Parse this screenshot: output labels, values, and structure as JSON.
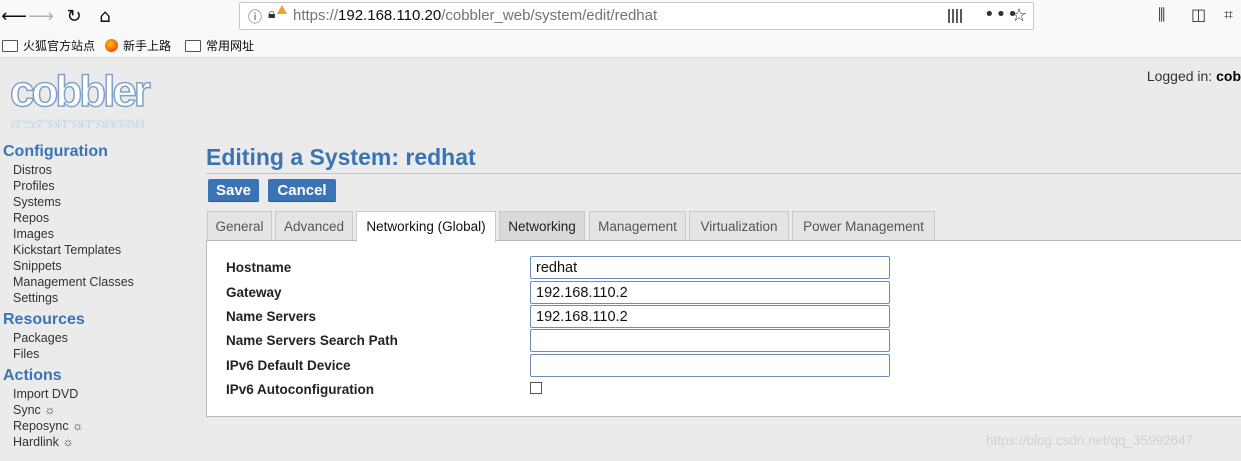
{
  "browser": {
    "url_prefix": "https://",
    "url_host": "192.168.110.20",
    "url_path": "/cobbler_web/system/edit/redhat",
    "bookmarks": [
      "火狐官方站点",
      "新手上路",
      "常用网址"
    ]
  },
  "header": {
    "logo_text": "cobbler",
    "logged_in_label": "Logged in:",
    "logged_in_user": "cob"
  },
  "sidebar": {
    "configuration": {
      "title": "Configuration",
      "items": [
        "Distros",
        "Profiles",
        "Systems",
        "Repos",
        "Images",
        "Kickstart Templates",
        "Snippets",
        "Management Classes",
        "Settings"
      ]
    },
    "resources": {
      "title": "Resources",
      "items": [
        "Packages",
        "Files"
      ]
    },
    "actions": {
      "title": "Actions",
      "items": [
        "Import DVD",
        "Sync ☼",
        "Reposync ☼",
        "Hardlink ☼"
      ]
    }
  },
  "main": {
    "title": "Editing a System: redhat",
    "save_label": "Save",
    "cancel_label": "Cancel",
    "tabs": [
      "General",
      "Advanced",
      "Networking (Global)",
      "Networking",
      "Management",
      "Virtualization",
      "Power Management"
    ],
    "active_tab": "Networking (Global)",
    "fields": {
      "hostname": {
        "label": "Hostname",
        "value": "redhat"
      },
      "gateway": {
        "label": "Gateway",
        "value": "192.168.110.2"
      },
      "name_servers": {
        "label": "Name Servers",
        "value": "192.168.110.2"
      },
      "search_path": {
        "label": "Name Servers Search Path",
        "value": ""
      },
      "ipv6_device": {
        "label": "IPv6 Default Device",
        "value": ""
      },
      "ipv6_autoconf": {
        "label": "IPv6 Autoconfiguration",
        "checked": false
      }
    }
  },
  "watermark": "https://blog.csdn.net/qq_35992647",
  "colors": {
    "accent": "#3b74b6"
  }
}
